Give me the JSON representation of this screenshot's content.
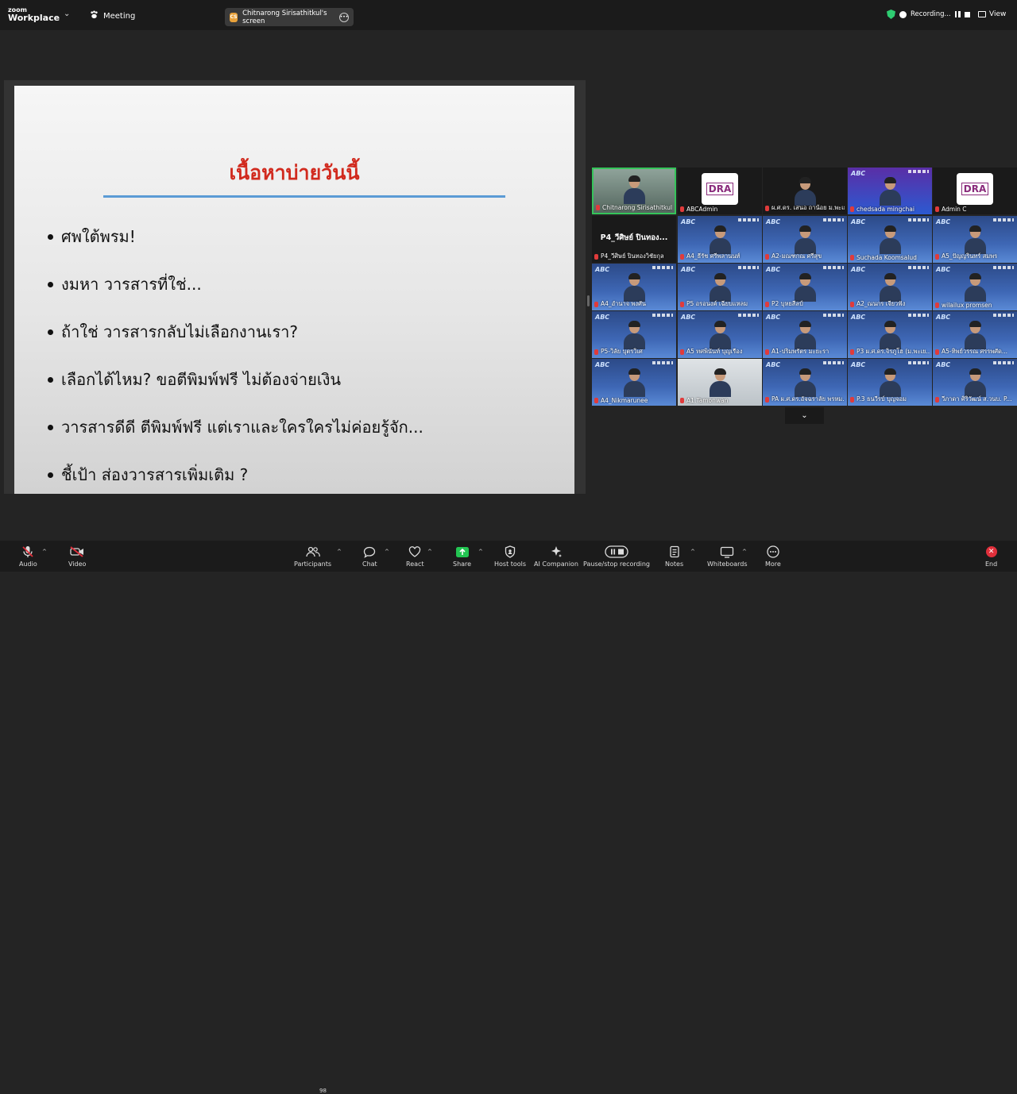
{
  "topbar": {
    "logo_line1": "zoom",
    "logo_line2": "Workplace",
    "meeting_label": "Meeting",
    "share_badge": "CS",
    "share_tab_label": "Chitnarong Sirisathitkul's screen",
    "recording_label": "Recording...",
    "view_label": "View"
  },
  "slide": {
    "title": "เนื้อหาบ่ายวันนี้",
    "bullets": [
      "ศพใต้พรม!",
      "งมหา วารสารที่ใช่...",
      "ถ้าใช่ วารสารกลับไม่เลือกงานเรา?",
      "เลือกได้ไหม? ขอตีพิมพ์ฟรี ไม่ต้องจ่ายเงิน",
      "วารสารดีดี ตีพิมพ์ฟรี แต่เราและใครใครไม่ค่อยรู้จัก...",
      "ชี้เป้า ส่องวารสารเพิ่มเติม ?"
    ]
  },
  "gallery": {
    "tiles": [
      {
        "name": "Chitnarong Sirisathitkul",
        "style": "featured"
      },
      {
        "name": "ABCAdmin",
        "style": "dra"
      },
      {
        "name": "ผ.ศ.ดร. เสนอ ถาน้อย ม.พะเย...",
        "style": "dark"
      },
      {
        "name": "chedsada mingchai",
        "style": "violet"
      },
      {
        "name": "Admin C",
        "style": "dra"
      },
      {
        "name": "P4_วีศิษย์ ปินทองวิชัยกุล",
        "style": "dark",
        "big_label": "P4_วีศิษย์ ปินทอง..."
      },
      {
        "name": "A4_ธีรัช ศรีพลานนท์",
        "style": "abcbg"
      },
      {
        "name": "A2-มณฑกณ ศรีสุข",
        "style": "abcbg"
      },
      {
        "name": "Suchada Koomsalud",
        "style": "abcbg"
      },
      {
        "name": "A5_ปัญญรินทร์ สมพร",
        "style": "abcbg"
      },
      {
        "name": "A4_อำนาจ พงศัน",
        "style": "abcbg"
      },
      {
        "name": "P5 อรอนงค์ เฉียบแหลม",
        "style": "abcbg"
      },
      {
        "name": "P2 บุหยสีลป์",
        "style": "abcbg"
      },
      {
        "name": "A2_ณนกร เจียวฟัง",
        "style": "abcbg"
      },
      {
        "name": "wilailux promsen",
        "style": "abcbg"
      },
      {
        "name": "P5-วิลัย บุตรวิเศ",
        "style": "abcbg"
      },
      {
        "name": "A5 ทศพินันท์ บุญเรือง",
        "style": "abcbg"
      },
      {
        "name": "A1-ปริมพรัตร มะยะรา",
        "style": "abcbg"
      },
      {
        "name": "P3 ผ.ศ.ดร.จิรภูโฮ (ม.พะเย...",
        "style": "abcbg"
      },
      {
        "name": "A5-ทิพย์วรรณ ศรรพศัด...",
        "style": "abcbg"
      },
      {
        "name": "A4_Nikmarunee",
        "style": "abcbg"
      },
      {
        "name": "A1.Tamonwan",
        "style": "room"
      },
      {
        "name": "PA ผ.ศ.ดร.อัจฉราลัย พรหม...",
        "style": "abcbg"
      },
      {
        "name": "P.3 ธนวีรบ์ บุญจอม",
        "style": "abcbg"
      },
      {
        "name": "วีภาดา ศิริวัฒน์ ส.วนบ. P...",
        "style": "abcbg"
      }
    ],
    "dra_text": "DRA",
    "abc_text": "ABC"
  },
  "toolbar": {
    "participant_count": "98",
    "items": [
      {
        "label": "Audio"
      },
      {
        "label": "Video"
      },
      {
        "label": "Participants"
      },
      {
        "label": "Chat"
      },
      {
        "label": "React"
      },
      {
        "label": "Share"
      },
      {
        "label": "Host tools"
      },
      {
        "label": "AI Companion"
      },
      {
        "label": "Pause/stop recording"
      },
      {
        "label": "Notes"
      },
      {
        "label": "Whiteboards"
      },
      {
        "label": "More"
      },
      {
        "label": "End"
      }
    ]
  },
  "colors": {
    "slide_title": "#d12a1e",
    "slide_rule": "#5b9bd5",
    "featured_border": "#35c45a",
    "end_red": "#e02f3b",
    "share_green": "#23c552"
  }
}
